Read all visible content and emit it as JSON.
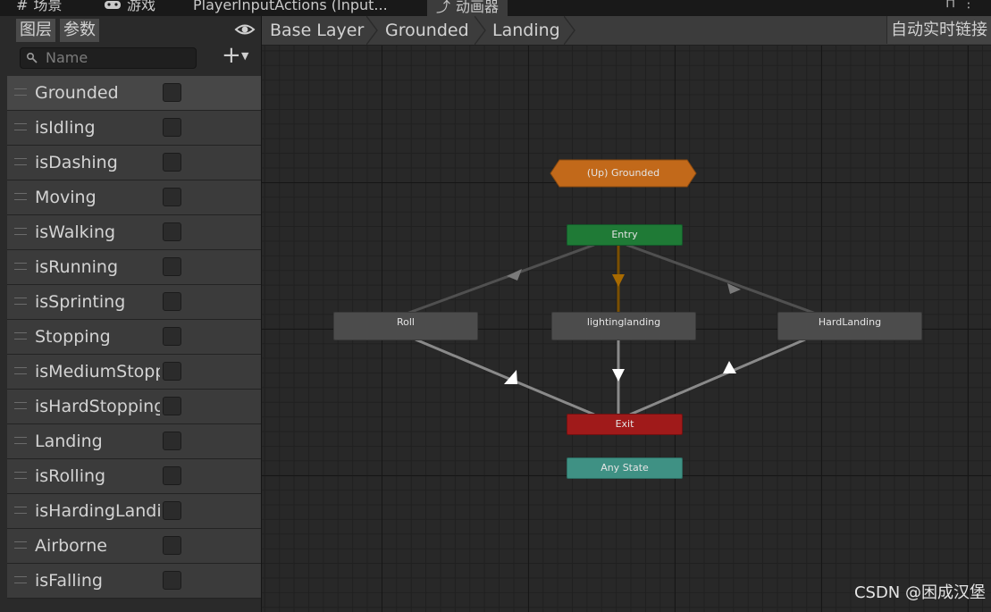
{
  "tabs": [
    {
      "label": "场景",
      "icon": "hash-icon"
    },
    {
      "label": "游戏",
      "icon": "gamepad-icon"
    },
    {
      "label": "PlayerInputActions (Input...",
      "icon": ""
    },
    {
      "label": "动画器",
      "icon": "animator-icon"
    }
  ],
  "left_panel": {
    "tab_layers": "图层",
    "tab_params": "参数",
    "search_placeholder": "Name",
    "parameters": [
      {
        "name": "Grounded",
        "type": "bool",
        "value": false,
        "selected": true
      },
      {
        "name": "isIdling",
        "type": "bool",
        "value": false
      },
      {
        "name": "isDashing",
        "type": "bool",
        "value": false
      },
      {
        "name": "Moving",
        "type": "bool",
        "value": false
      },
      {
        "name": "isWalking",
        "type": "bool",
        "value": false
      },
      {
        "name": "isRunning",
        "type": "bool",
        "value": false
      },
      {
        "name": "isSprinting",
        "type": "bool",
        "value": false
      },
      {
        "name": "Stopping",
        "type": "bool",
        "value": false
      },
      {
        "name": "isMediumStopping",
        "type": "bool",
        "value": false
      },
      {
        "name": "isHardStopping",
        "type": "bool",
        "value": false
      },
      {
        "name": "Landing",
        "type": "bool",
        "value": false
      },
      {
        "name": "isRolling",
        "type": "bool",
        "value": false
      },
      {
        "name": "isHardingLanding",
        "type": "bool",
        "value": false
      },
      {
        "name": "Airborne",
        "type": "bool",
        "value": false
      },
      {
        "name": "isFalling",
        "type": "bool",
        "value": false
      }
    ]
  },
  "breadcrumb": [
    "Base Layer",
    "Grounded",
    "Landing"
  ],
  "live_link": "自动实时链接",
  "graph": {
    "nodes": {
      "up": "(Up) Grounded",
      "entry": "Entry",
      "roll": "Roll",
      "lighting": "lightinglanding",
      "hard": "HardLanding",
      "exit": "Exit",
      "any": "Any State"
    }
  },
  "colors": {
    "entry": "#1f7a36",
    "exit": "#a01a1a",
    "any_state": "#3f9184",
    "up_state": "#c2691a",
    "default_transition": "#a86a00"
  },
  "watermark": "CSDN @困成汉堡"
}
